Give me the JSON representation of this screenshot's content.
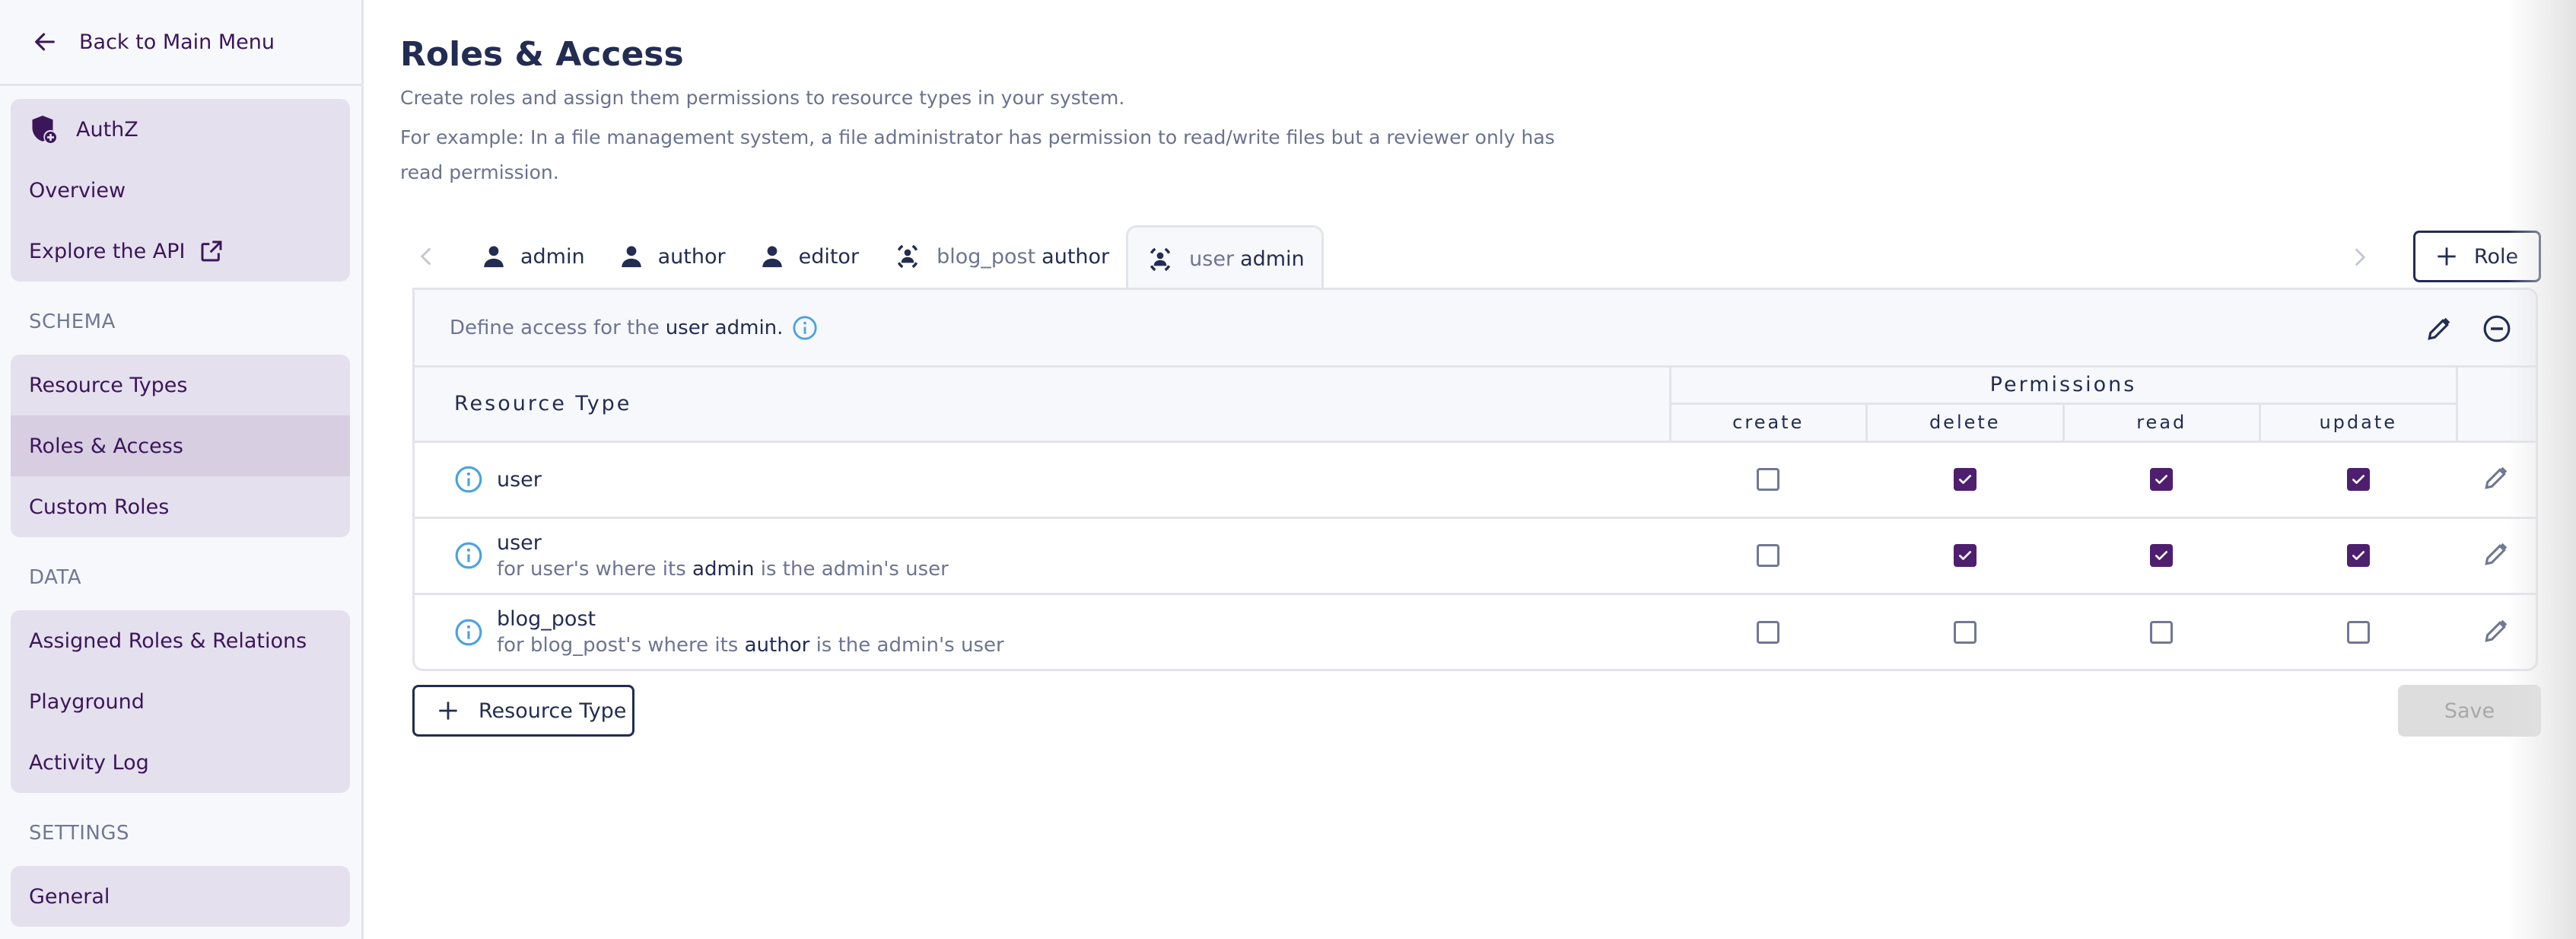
{
  "sidebar": {
    "back_label": "Back to Main Menu",
    "app": {
      "name": "AuthZ",
      "icon": "shield-plus-icon",
      "items": [
        {
          "label": "Overview"
        },
        {
          "label": "Explore the API",
          "icon": "external-link-icon"
        }
      ]
    },
    "sections": [
      {
        "label": "SCHEMA",
        "items": [
          {
            "label": "Resource Types",
            "active": false
          },
          {
            "label": "Roles & Access",
            "active": true
          },
          {
            "label": "Custom Roles",
            "active": false
          }
        ]
      },
      {
        "label": "DATA",
        "items": [
          {
            "label": "Assigned Roles & Relations",
            "active": false
          },
          {
            "label": "Playground",
            "active": false
          },
          {
            "label": "Activity Log",
            "active": false
          }
        ]
      },
      {
        "label": "SETTINGS",
        "items": [
          {
            "label": "General",
            "active": false
          }
        ]
      }
    ]
  },
  "page": {
    "title": "Roles & Access",
    "description": "Create roles and assign them permissions to resource types in your system.",
    "example": "For example: In a file management system, a file administrator has permission to read/write files but a reviewer only has read permission."
  },
  "tabs": [
    {
      "prefix": "",
      "label": "admin",
      "icon": "person-icon",
      "active": false
    },
    {
      "prefix": "",
      "label": "author",
      "icon": "person-icon",
      "active": false
    },
    {
      "prefix": "",
      "label": "editor",
      "icon": "person-icon",
      "active": false
    },
    {
      "prefix": "blog_post",
      "label": "author",
      "icon": "person-dashed-frame-icon",
      "active": false
    },
    {
      "prefix": "user",
      "label": "admin",
      "icon": "person-dashed-frame-icon",
      "active": true
    }
  ],
  "add_role_label": "Role",
  "card": {
    "define_prefix": "Define access for the",
    "define_role": "user admin.",
    "table": {
      "resource_header": "Resource Type",
      "permissions_header": "Permissions",
      "permission_columns": [
        "create",
        "delete",
        "read",
        "update"
      ],
      "rows": [
        {
          "name": "user",
          "sub_prefix": "",
          "sub_relation": "",
          "sub_suffix": "",
          "perms": [
            false,
            true,
            true,
            true
          ]
        },
        {
          "name": "user",
          "sub_prefix": "for user's where its",
          "sub_relation": "admin",
          "sub_suffix": "is the admin's user",
          "perms": [
            false,
            true,
            true,
            true
          ]
        },
        {
          "name": "blog_post",
          "sub_prefix": "for blog_post's where its",
          "sub_relation": "author",
          "sub_suffix": "is the admin's user",
          "perms": [
            false,
            false,
            false,
            false
          ]
        }
      ]
    }
  },
  "add_resource_type_label": "Resource Type",
  "save_label": "Save",
  "colors": {
    "accent": "#4e1f6e",
    "text_primary": "#232c52",
    "text_muted": "#6e7492",
    "nav_bg": "#e5e0ee",
    "nav_active_bg": "#d7cee2",
    "info_blue": "#4aa3df"
  }
}
